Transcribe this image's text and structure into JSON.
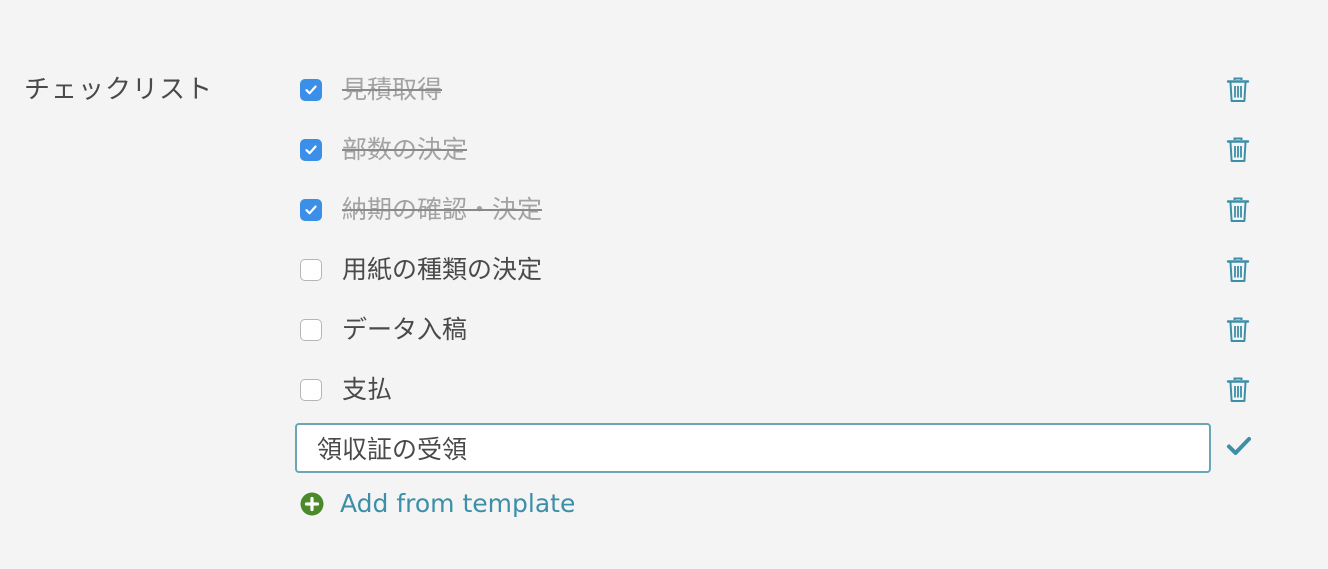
{
  "section": {
    "label": "チェックリスト"
  },
  "checklist": {
    "items": [
      {
        "label": "見積取得",
        "checked": true
      },
      {
        "label": "部数の決定",
        "checked": true
      },
      {
        "label": "納期の確認・決定",
        "checked": true
      },
      {
        "label": "用紙の種類の決定",
        "checked": false
      },
      {
        "label": "データ入稿",
        "checked": false
      },
      {
        "label": "支払",
        "checked": false
      }
    ],
    "new_item_value": "領収証の受領",
    "add_template_label": "Add from template"
  },
  "colors": {
    "checkbox_checked": "#3b8fe8",
    "trash_icon": "#3d8fa8",
    "confirm_icon": "#3d8fa8",
    "add_icon": "#4a8a2a",
    "link": "#3d8fa8",
    "input_border": "#6aa6b8"
  },
  "icons": {
    "delete": "trash-icon",
    "confirm": "checkmark-icon",
    "add": "plus-circle-icon"
  }
}
